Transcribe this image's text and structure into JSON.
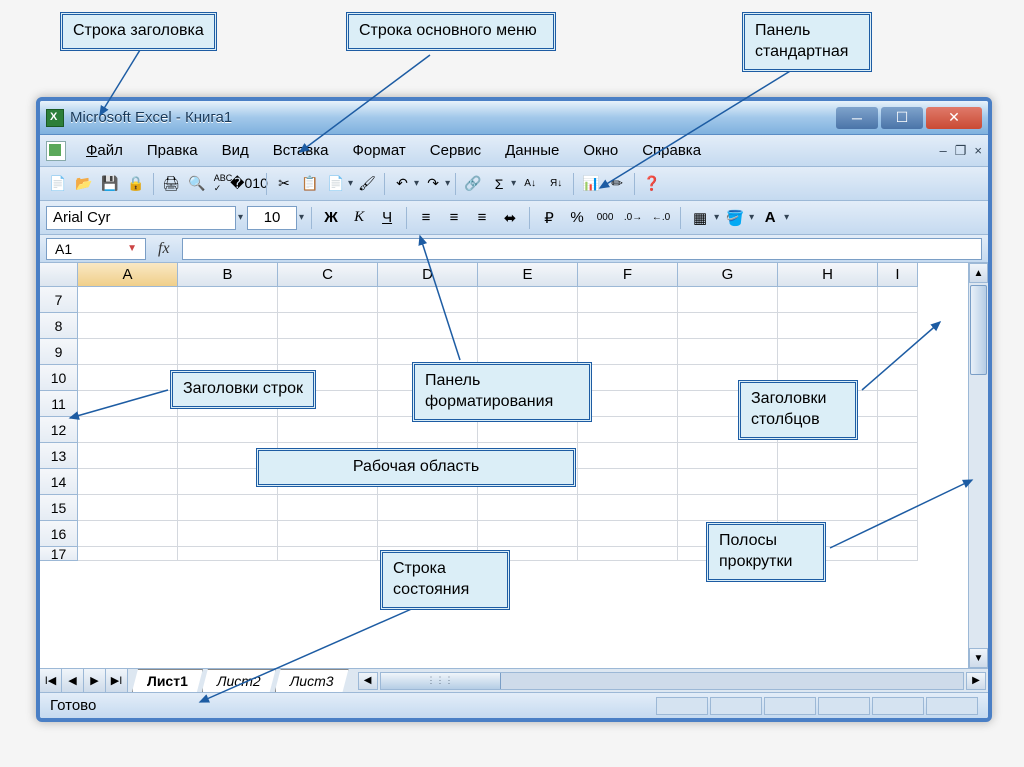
{
  "callouts": {
    "titlebar": "Строка заголовка",
    "menubar": "Строка основного меню",
    "std_toolbar": "Панель стандартная",
    "row_headers": "Заголовки строк",
    "format_panel": "Панель форматирования",
    "col_headers": "Заголовки столбцов",
    "work_area": "Рабочая область",
    "status_row": "Строка состояния",
    "scrollbars": "Полосы прокрутки"
  },
  "window": {
    "title": "Microsoft Excel - Книга1"
  },
  "menu": {
    "file": "Файл",
    "edit": "Правка",
    "view": "Вид",
    "insert": "Вставка",
    "format": "Формат",
    "tools": "Сервис",
    "data": "Данные",
    "window": "Окно",
    "help": "Справка"
  },
  "format": {
    "font": "Arial Cyr",
    "size": "10",
    "bold": "Ж",
    "italic": "К",
    "underline": "Ч"
  },
  "namebox": "A1",
  "fx": "fx",
  "columns": [
    "A",
    "B",
    "C",
    "D",
    "E",
    "F",
    "G",
    "H",
    "I"
  ],
  "rows": [
    "7",
    "8",
    "9",
    "10",
    "11",
    "12",
    "13",
    "14",
    "15",
    "16",
    "17"
  ],
  "sheets": {
    "s1": "Лист1",
    "s2": "Лист2",
    "s3": "Лист3"
  },
  "status": "Готово",
  "icons": {
    "sigma": "Σ",
    "percent": "%"
  }
}
